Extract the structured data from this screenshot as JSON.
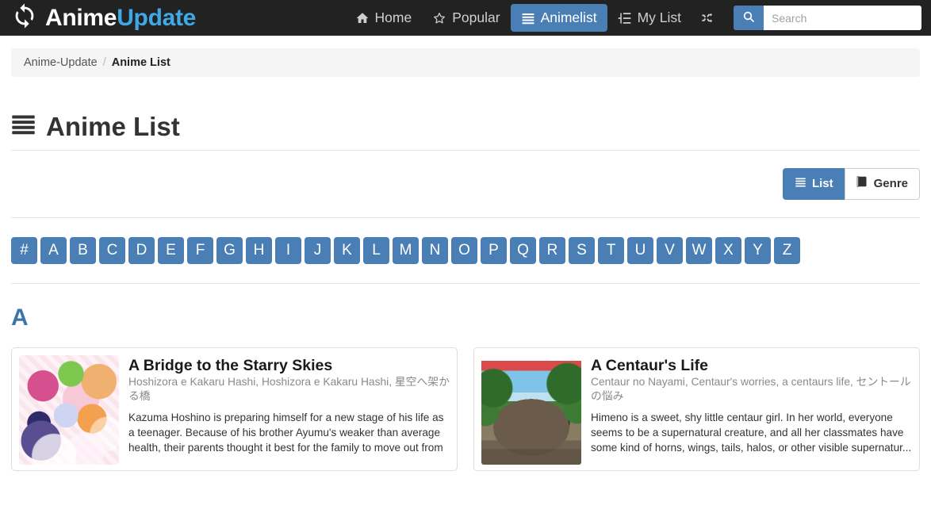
{
  "navbar": {
    "brand": {
      "icon": "refresh-sync-icon",
      "text_primary": "Anime",
      "text_secondary": "Update"
    },
    "links": [
      {
        "id": "home",
        "label": "Home",
        "icon": "home-icon",
        "active": false
      },
      {
        "id": "popular",
        "label": "Popular",
        "icon": "star-icon",
        "active": false
      },
      {
        "id": "animelist",
        "label": "Animelist",
        "icon": "bars-icon",
        "active": true
      },
      {
        "id": "mylist",
        "label": "My List",
        "icon": "list-indent-icon",
        "active": false
      },
      {
        "id": "random",
        "label": "",
        "icon": "shuffle-icon",
        "active": false
      }
    ],
    "search": {
      "icon": "search-icon",
      "placeholder": "Search",
      "value": ""
    },
    "colors": {
      "bar_bg": "#222222",
      "accent": "#4a7fb5",
      "brand_blue": "#3fa9e8"
    }
  },
  "breadcrumb": {
    "home_label": "Anime-Update",
    "separator": "/",
    "current_label": "Anime List"
  },
  "page": {
    "title": "Anime List",
    "title_icon": "bars-icon",
    "section_letter": "A"
  },
  "view_toggle": {
    "buttons": [
      {
        "id": "list",
        "label": "List",
        "icon": "bars-icon",
        "active": true
      },
      {
        "id": "genre",
        "label": "Genre",
        "icon": "book-icon",
        "active": false
      }
    ]
  },
  "alphabet": {
    "letters": [
      "#",
      "A",
      "B",
      "C",
      "D",
      "E",
      "F",
      "G",
      "H",
      "I",
      "J",
      "K",
      "L",
      "M",
      "N",
      "O",
      "P",
      "Q",
      "R",
      "S",
      "T",
      "U",
      "V",
      "W",
      "X",
      "Y",
      "Z"
    ]
  },
  "cards": [
    {
      "title": "A Bridge to the Starry Skies",
      "alt_titles": "Hoshizora e Kakaru Hashi, Hoshizora e Kakaru Hashi, 星空へ架かる橋",
      "description": "Kazuma Hoshino is preparing himself for a new stage of his life as a teenager. Because of his brother Ayumu's weaker than average health, their parents thought it best for the family to move out from ...",
      "thumb_name": "anime-cover-a-bridge-to-the-starry-skies"
    },
    {
      "title": "A Centaur's Life",
      "alt_titles": "Centaur no Nayami, Centaur's worries, a centaurs life, セントールの悩み",
      "description": "Himeno is a sweet, shy little centaur girl. In her world, everyone seems to be a supernatural creature, and all her classmates have some kind of horns, wings, tails, halos, or other visible supernatur...",
      "thumb_name": "anime-cover-a-centaurs-life"
    }
  ]
}
